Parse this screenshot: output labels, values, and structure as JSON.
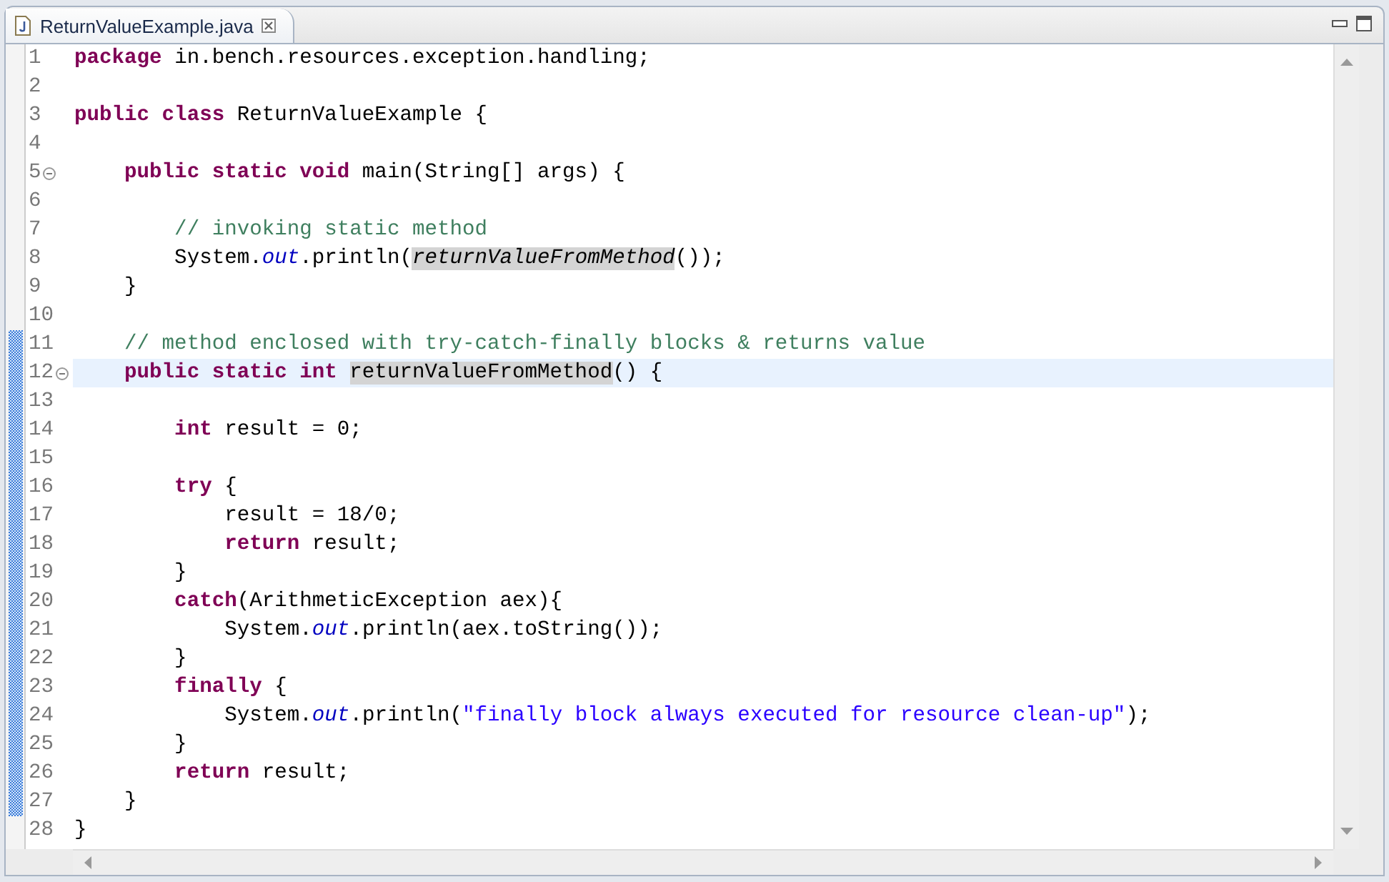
{
  "tab": {
    "title": "ReturnValueExample.java",
    "selected": true
  },
  "editor": {
    "lines": [
      {
        "number": "1",
        "in_range": false,
        "collapsible": false,
        "current": false,
        "tokens": [
          {
            "kind": "keyword",
            "text": "package"
          },
          {
            "kind": "plain",
            "text": " in.bench.resources.exception.handling;"
          }
        ]
      },
      {
        "number": "2",
        "in_range": false,
        "collapsible": false,
        "current": false
      },
      {
        "number": "3",
        "in_range": false,
        "collapsible": false,
        "current": false,
        "tokens": [
          {
            "kind": "keyword",
            "text": "public class"
          },
          {
            "kind": "plain",
            "text": " ReturnValueExample {"
          }
        ]
      },
      {
        "number": "4",
        "in_range": false,
        "collapsible": false,
        "current": false
      },
      {
        "number": "5",
        "in_range": false,
        "collapsible": true,
        "current": false,
        "tokens": [
          {
            "kind": "keyword",
            "text": "    public static void"
          },
          {
            "kind": "plain",
            "text": " main(String[] args) {"
          }
        ]
      },
      {
        "number": "6",
        "in_range": false,
        "collapsible": false,
        "current": false
      },
      {
        "number": "7",
        "in_range": false,
        "collapsible": false,
        "current": false,
        "tokens": [
          {
            "kind": "comment",
            "text": "        // invoking static method"
          }
        ]
      },
      {
        "number": "8",
        "in_range": false,
        "collapsible": false,
        "current": false,
        "tokens": [
          {
            "kind": "plain",
            "text": "        System."
          },
          {
            "kind": "field",
            "text": "out"
          },
          {
            "kind": "plain",
            "text": ".println("
          },
          {
            "kind": "occurrence_italic",
            "text": "returnValueFromMethod"
          },
          {
            "kind": "plain",
            "text": "());"
          }
        ]
      },
      {
        "number": "9",
        "in_range": false,
        "collapsible": false,
        "current": false,
        "tokens": [
          {
            "kind": "plain",
            "text": "    }"
          }
        ]
      },
      {
        "number": "10",
        "in_range": false,
        "collapsible": false,
        "current": false
      },
      {
        "number": "11",
        "in_range": true,
        "collapsible": false,
        "current": false,
        "tokens": [
          {
            "kind": "comment",
            "text": "    // method enclosed with try-catch-finally blocks & returns value"
          }
        ]
      },
      {
        "number": "12",
        "in_range": true,
        "collapsible": true,
        "current": true,
        "tokens": [
          {
            "kind": "keyword",
            "text": "    public static int "
          },
          {
            "kind": "occurrence",
            "text": "returnValueFromMethod"
          },
          {
            "kind": "plain",
            "text": "() {"
          }
        ]
      },
      {
        "number": "13",
        "in_range": true,
        "collapsible": false,
        "current": false
      },
      {
        "number": "14",
        "in_range": true,
        "collapsible": false,
        "current": false,
        "tokens": [
          {
            "kind": "keyword",
            "text": "        int"
          },
          {
            "kind": "plain",
            "text": " result = 0;"
          }
        ]
      },
      {
        "number": "15",
        "in_range": true,
        "collapsible": false,
        "current": false
      },
      {
        "number": "16",
        "in_range": true,
        "collapsible": false,
        "current": false,
        "tokens": [
          {
            "kind": "keyword",
            "text": "        try"
          },
          {
            "kind": "plain",
            "text": " {"
          }
        ]
      },
      {
        "number": "17",
        "in_range": true,
        "collapsible": false,
        "current": false,
        "tokens": [
          {
            "kind": "plain",
            "text": "            result = 18/0;"
          }
        ]
      },
      {
        "number": "18",
        "in_range": true,
        "collapsible": false,
        "current": false,
        "tokens": [
          {
            "kind": "keyword",
            "text": "            return"
          },
          {
            "kind": "plain",
            "text": " result;"
          }
        ]
      },
      {
        "number": "19",
        "in_range": true,
        "collapsible": false,
        "current": false,
        "tokens": [
          {
            "kind": "plain",
            "text": "        }"
          }
        ]
      },
      {
        "number": "20",
        "in_range": true,
        "collapsible": false,
        "current": false,
        "tokens": [
          {
            "kind": "keyword",
            "text": "        catch"
          },
          {
            "kind": "plain",
            "text": "(ArithmeticException aex){"
          }
        ]
      },
      {
        "number": "21",
        "in_range": true,
        "collapsible": false,
        "current": false,
        "tokens": [
          {
            "kind": "plain",
            "text": "            System."
          },
          {
            "kind": "field",
            "text": "out"
          },
          {
            "kind": "plain",
            "text": ".println(aex.toString());"
          }
        ]
      },
      {
        "number": "22",
        "in_range": true,
        "collapsible": false,
        "current": false,
        "tokens": [
          {
            "kind": "plain",
            "text": "        }"
          }
        ]
      },
      {
        "number": "23",
        "in_range": true,
        "collapsible": false,
        "current": false,
        "tokens": [
          {
            "kind": "keyword",
            "text": "        finally"
          },
          {
            "kind": "plain",
            "text": " {"
          }
        ]
      },
      {
        "number": "24",
        "in_range": true,
        "collapsible": false,
        "current": false,
        "tokens": [
          {
            "kind": "plain",
            "text": "            System."
          },
          {
            "kind": "field",
            "text": "out"
          },
          {
            "kind": "plain",
            "text": ".println("
          },
          {
            "kind": "string",
            "text": "\"finally block always executed for resource clean-up\""
          },
          {
            "kind": "plain",
            "text": ");"
          }
        ]
      },
      {
        "number": "25",
        "in_range": true,
        "collapsible": false,
        "current": false,
        "tokens": [
          {
            "kind": "plain",
            "text": "        }"
          }
        ]
      },
      {
        "number": "26",
        "in_range": true,
        "collapsible": false,
        "current": false,
        "tokens": [
          {
            "kind": "keyword",
            "text": "        return"
          },
          {
            "kind": "plain",
            "text": " result;"
          }
        ]
      },
      {
        "number": "27",
        "in_range": true,
        "collapsible": false,
        "current": false,
        "tokens": [
          {
            "kind": "plain",
            "text": "    }"
          }
        ]
      },
      {
        "number": "28",
        "in_range": false,
        "collapsible": false,
        "current": false,
        "tokens": [
          {
            "kind": "plain",
            "text": "}"
          }
        ]
      }
    ]
  }
}
